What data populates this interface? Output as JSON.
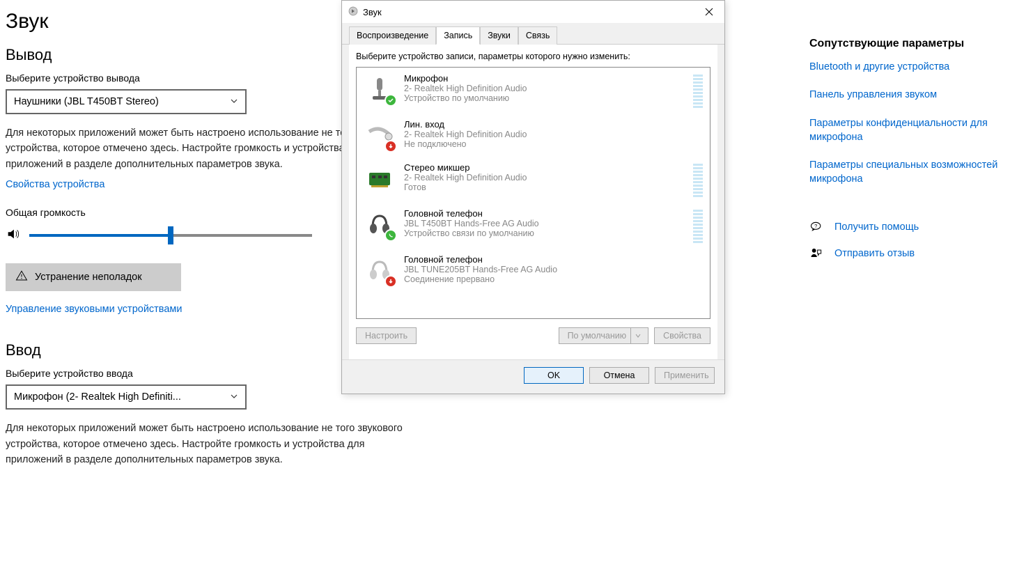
{
  "page": {
    "title": "Звук",
    "output_heading": "Вывод",
    "output_label": "Выберите устройство вывода",
    "output_combo": "Наушники (JBL T450BT Stereo)",
    "output_desc": "Для некоторых приложений может быть настроено использование не того звукового устройства, которое отмечено здесь. Настройте громкость и устройства для приложений в разделе дополнительных параметров звука.",
    "device_props": "Свойства устройства",
    "volume_label": "Общая громкость",
    "troubleshoot": "Устранение неполадок",
    "manage_devices": "Управление звуковыми устройствами",
    "input_heading": "Ввод",
    "input_label": "Выберите устройство ввода",
    "input_combo": "Микрофон (2- Realtek High Definiti...",
    "input_desc": "Для некоторых приложений может быть настроено использование не того звукового устройства, которое отмечено здесь. Настройте громкость и устройства для приложений в разделе дополнительных параметров звука."
  },
  "right": {
    "heading": "Сопутствующие параметры",
    "links": [
      "Bluetooth и другие устройства",
      "Панель управления звуком",
      "Параметры конфиденциальности для микрофона",
      "Параметры специальных возможностей микрофона"
    ],
    "help": "Получить помощь",
    "feedback": "Отправить отзыв"
  },
  "dialog": {
    "title": "Звук",
    "tabs": [
      "Воспроизведение",
      "Запись",
      "Звуки",
      "Связь"
    ],
    "active_tab": 1,
    "instruction": "Выберите устройство записи, параметры которого нужно изменить:",
    "devices": [
      {
        "name": "Микрофон",
        "sub": "2- Realtek High Definition Audio",
        "status": "Устройство по умолчанию",
        "badge": "green-check",
        "icon": "mic",
        "meter": true
      },
      {
        "name": "Лин. вход",
        "sub": "2- Realtek High Definition Audio",
        "status": "Не подключено",
        "badge": "red-down",
        "icon": "linein",
        "meter": false
      },
      {
        "name": "Стерео микшер",
        "sub": "2- Realtek High Definition Audio",
        "status": "Готов",
        "badge": "none",
        "icon": "card",
        "meter": true
      },
      {
        "name": "Головной телефон",
        "sub": "JBL T450BT Hands-Free AG Audio",
        "status": "Устройство связи по умолчанию",
        "badge": "green-phone",
        "icon": "headset",
        "meter": true
      },
      {
        "name": "Головной телефон",
        "sub": "JBL TUNE205BT Hands-Free AG Audio",
        "status": "Соединение прервано",
        "badge": "red-down",
        "icon": "headset-grey",
        "meter": false
      }
    ],
    "buttons": {
      "configure": "Настроить",
      "default": "По умолчанию",
      "properties": "Свойства",
      "ok": "OK",
      "cancel": "Отмена",
      "apply": "Применить"
    }
  }
}
